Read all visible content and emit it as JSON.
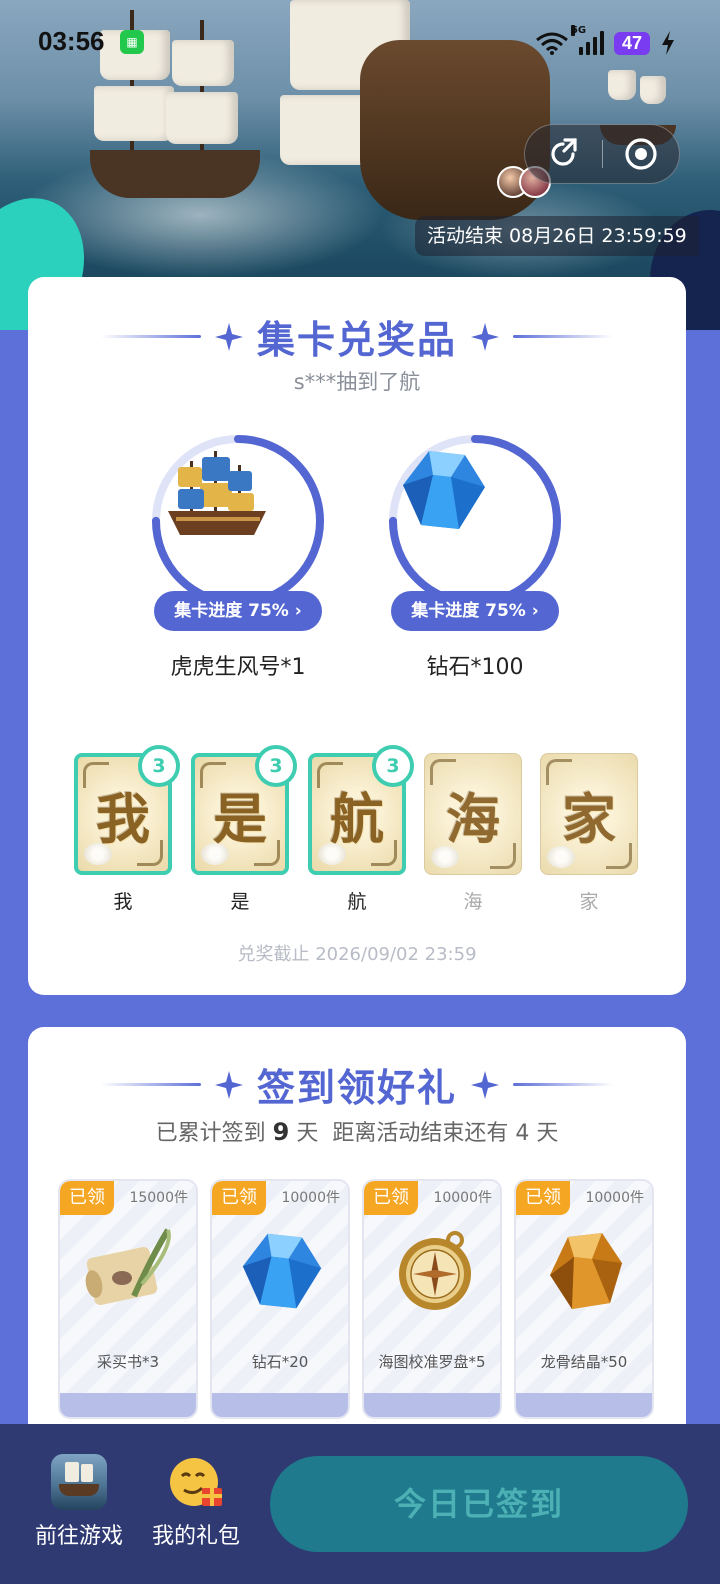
{
  "status_bar": {
    "time": "03:56",
    "network": "5G",
    "battery": "47"
  },
  "banner": {
    "end_text": "活动结束 08月26日 23:59:59"
  },
  "collect_section": {
    "title": "集卡兑奖品",
    "ticker": "s***抽到了航",
    "prizes": [
      {
        "name": "虎虎生风号*1",
        "progress_label": "集卡进度 75%",
        "progress": 0.75,
        "icon": "sailing-ship-icon"
      },
      {
        "name": "钻石*100",
        "progress_label": "集卡进度 75%",
        "progress": 0.75,
        "icon": "diamond-icon"
      }
    ],
    "cards": [
      {
        "glyph": "我",
        "label": "我",
        "count": "3",
        "owned": true
      },
      {
        "glyph": "是",
        "label": "是",
        "count": "3",
        "owned": true
      },
      {
        "glyph": "航",
        "label": "航",
        "count": "3",
        "owned": true
      },
      {
        "glyph": "海",
        "label": "海",
        "owned": false
      },
      {
        "glyph": "家",
        "label": "家",
        "owned": false
      }
    ],
    "deadline": "兑奖截止 2026/09/02 23:59"
  },
  "signin_section": {
    "title": "签到领好礼",
    "summary_prefix": "已累计签到 ",
    "summary_days": "9",
    "summary_suffix": " 天  距离活动结束还有 4 天",
    "rewards": [
      {
        "badge": "已领",
        "stock": "15000件",
        "name": "采买书*3",
        "icon": "scroll-quill-icon"
      },
      {
        "badge": "已领",
        "stock": "10000件",
        "name": "钻石*20",
        "icon": "diamond-icon"
      },
      {
        "badge": "已领",
        "stock": "10000件",
        "name": "海图校准罗盘*5",
        "icon": "compass-icon"
      },
      {
        "badge": "已领",
        "stock": "10000件",
        "name": "龙骨结晶*50",
        "icon": "amber-crystal-icon"
      }
    ]
  },
  "bottom_bar": {
    "go_game": "前往游戏",
    "my_gifts": "我的礼包",
    "signed_button": "今日已签到"
  },
  "colors": {
    "accent": "#5466d1",
    "teal": "#3ecdb0",
    "badge": "#f5a623",
    "bottom_bar": "#2f3a73"
  }
}
